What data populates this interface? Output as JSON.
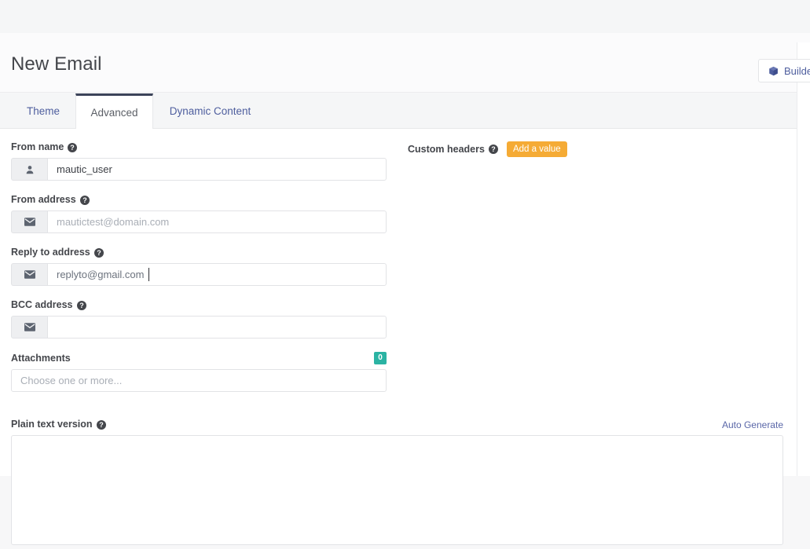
{
  "header": {
    "title": "New Email",
    "builder_button": {
      "label": "Builder",
      "icon": "cube-icon"
    }
  },
  "tabs": [
    {
      "label": "Theme",
      "active": false
    },
    {
      "label": "Advanced",
      "active": true
    },
    {
      "label": "Dynamic Content",
      "active": false
    }
  ],
  "form": {
    "from_name": {
      "label": "From name",
      "value": "mautic_user",
      "placeholder": "",
      "icon": "user-icon",
      "help": "help-icon"
    },
    "from_address": {
      "label": "From address",
      "value": "",
      "placeholder": "mautictest@domain.com",
      "icon": "envelope-icon",
      "help": "help-icon"
    },
    "reply_to_address": {
      "label": "Reply to address",
      "value": "replyto@gmail.com",
      "placeholder": "",
      "icon": "envelope-icon",
      "help": "help-icon",
      "focused": true
    },
    "bcc_address": {
      "label": "BCC address",
      "value": "",
      "placeholder": "",
      "icon": "envelope-icon",
      "help": "help-icon"
    },
    "attachments": {
      "label": "Attachments",
      "badge": "0",
      "placeholder": "Choose one or more..."
    },
    "plain_text": {
      "label": "Plain text version",
      "value": "",
      "placeholder": "",
      "help": "help-icon",
      "auto_generate_label": "Auto Generate"
    },
    "custom_headers": {
      "label": "Custom headers",
      "help": "help-icon",
      "add_button_label": "Add a value"
    }
  },
  "colors": {
    "accent_link": "#4e5e9e",
    "badge_teal": "#2bb3a3",
    "button_orange": "#f5ab35",
    "active_tab_border": "#3b4359",
    "label_text": "#44464b"
  }
}
